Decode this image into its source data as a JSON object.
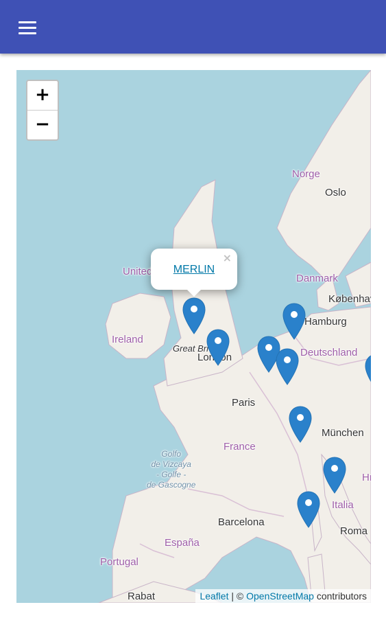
{
  "appbar": {
    "menu_icon": "hamburger-menu-icon",
    "color": "#3f51b5"
  },
  "map": {
    "zoom_in_label": "+",
    "zoom_out_label": "−",
    "popup": {
      "link_text": "MERLIN",
      "close_label": "×"
    },
    "attribution": {
      "leaflet": "Leaflet",
      "separator": " | © ",
      "osm": "OpenStreetMap",
      "suffix": " contributors"
    },
    "labels": {
      "norge": "Norge",
      "oslo": "Oslo",
      "danmark": "Danmark",
      "kobenhavn": "København",
      "hamburg": "Hamburg",
      "deutschland": "Deutschland",
      "united": "United",
      "ireland": "Ireland",
      "great_britain": "Great Bri",
      "london": "London",
      "paris": "Paris",
      "france": "France",
      "munchen": "München",
      "italia": "Italia",
      "roma": "Roma",
      "barcelona": "Barcelona",
      "espana": "España",
      "portugal": "Portugal",
      "rabat": "Rabat",
      "hr": "Hr",
      "golfe": "Golfo\nde Vizcaya\n- Golfe -\nde Gascogne"
    },
    "marker_color": "#2a81cb",
    "marker_count": 10
  }
}
